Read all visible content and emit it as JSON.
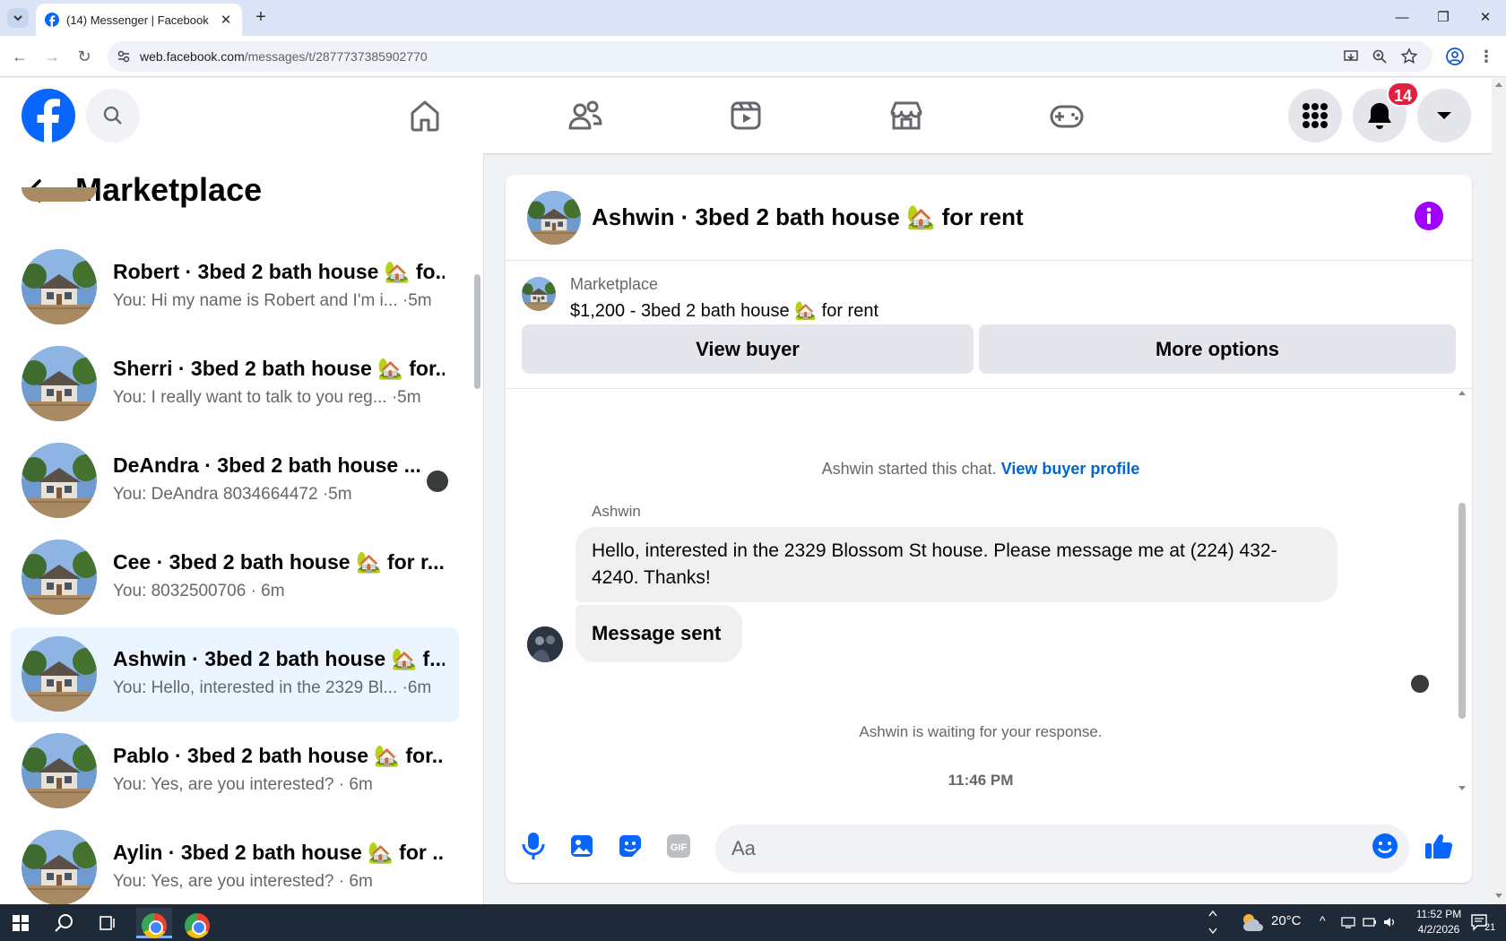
{
  "browser": {
    "tab_title": "(14) Messenger | Facebook",
    "new_tab": "+",
    "url_host": "web.facebook.com",
    "url_path": "/messages/t/2877737385902770"
  },
  "fb_header": {
    "notification_count": "14"
  },
  "left_panel": {
    "title": "Marketplace",
    "conversations": [
      {
        "name": "Robert · 3bed 2 bath house 🏡 fo...",
        "preview": "You: Hi my name is Robert and I'm i... ·5m"
      },
      {
        "name": "Sherri · 3bed 2 bath house 🏡 for...",
        "preview": "You: I really want to talk to you reg...  ·5m"
      },
      {
        "name": "DeAndra · 3bed 2 bath house ...",
        "preview": "You: DeAndra 8034664472 ·5m"
      },
      {
        "name": "Cee · 3bed 2 bath house 🏡 for r...",
        "preview": "You: 8032500706 · 6m"
      },
      {
        "name": "Ashwin · 3bed 2 bath house 🏡 f...",
        "preview": "You: Hello, interested in the 2329 Bl... ·6m"
      },
      {
        "name": "Pablo · 3bed 2 bath house 🏡 for...",
        "preview": "You: Yes, are you interested? · 6m"
      },
      {
        "name": "Aylin · 3bed 2 bath house 🏡 for ...",
        "preview": "You: Yes, are you interested? · 6m"
      }
    ]
  },
  "chat": {
    "title": "Ashwin · 3bed 2 bath house 🏡 for rent",
    "listing_label": "Marketplace",
    "listing_title": "$1,200 - 3bed 2 bath house 🏡 for rent",
    "view_buyer": "View buyer",
    "more_options": "More options",
    "started_text": "Ashwin started this chat.",
    "view_buyer_profile": "View buyer profile",
    "sender": "Ashwin",
    "message_1": "Hello, interested in the 2329 Blossom St house. Please message me at (224) 432-4240. Thanks!",
    "message_2": "Message sent",
    "waiting": "Ashwin is waiting for your response.",
    "timestamp": "11:46 PM",
    "input_placeholder": "Aa"
  },
  "taskbar": {
    "weather": "20°C",
    "time": "11:52 PM",
    "date": "4/2/2026",
    "notifications": "21"
  },
  "colors": {
    "fb_blue": "#0866ff",
    "active_conv": "#ebf5ff",
    "badge_red": "#e41e3f",
    "info_purple": "#a100ff"
  }
}
